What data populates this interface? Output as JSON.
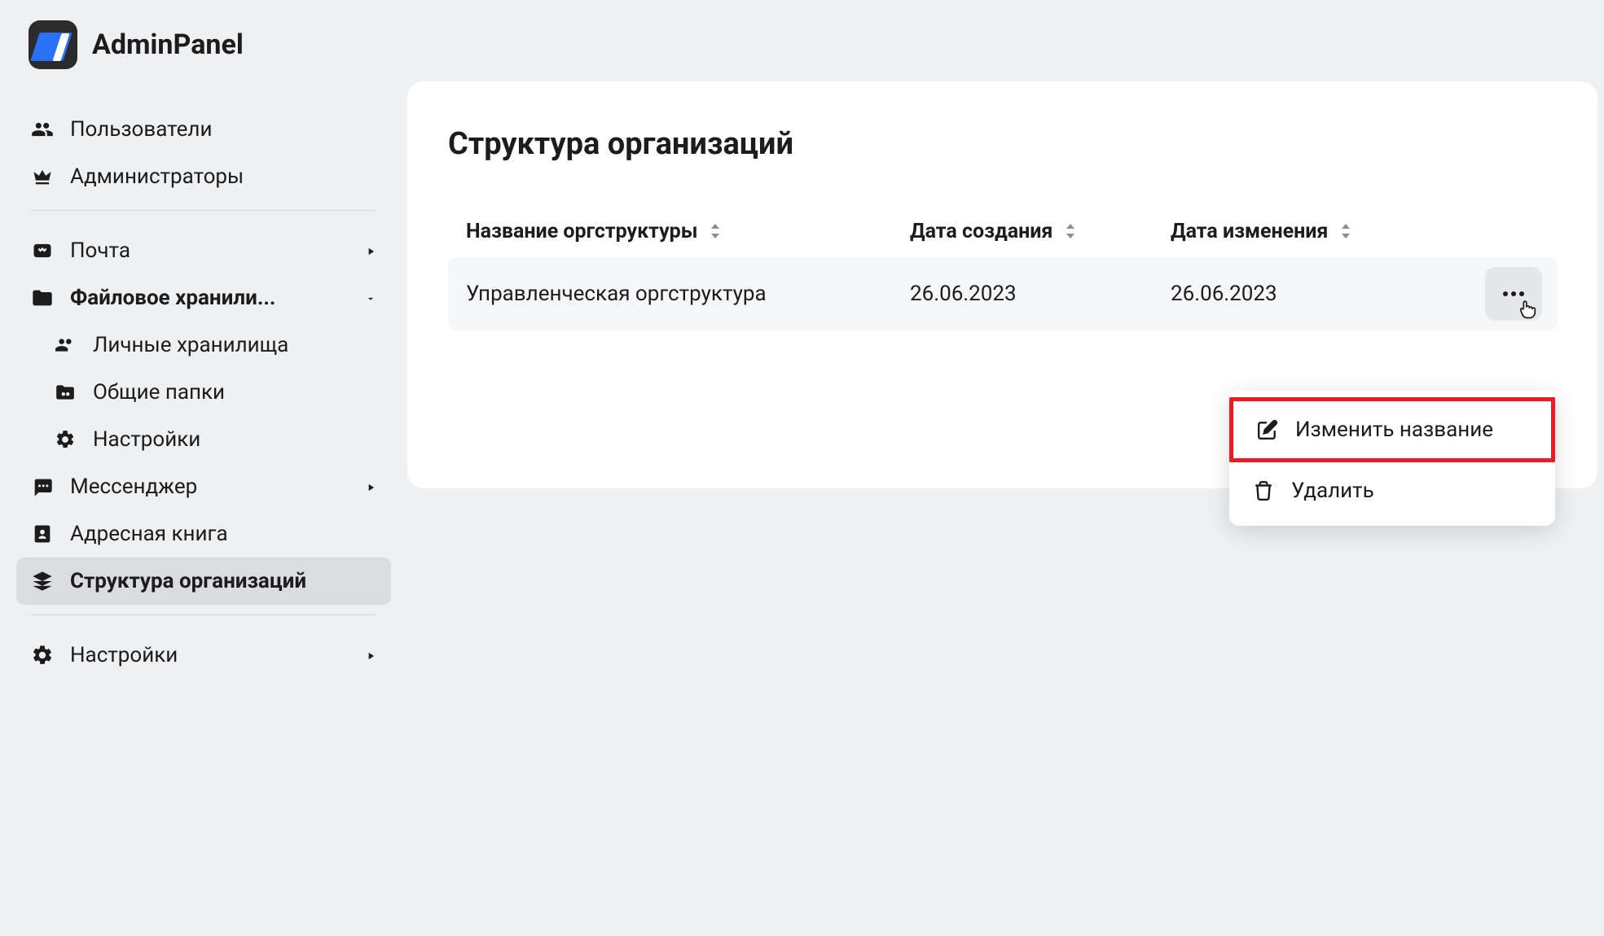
{
  "app_name": "AdminPanel",
  "sidebar": {
    "items": [
      {
        "label": "Пользователи"
      },
      {
        "label": "Администраторы"
      },
      {
        "label": "Почта"
      },
      {
        "label": "Файловое хранили..."
      },
      {
        "label": "Личные хранилища"
      },
      {
        "label": "Общие папки"
      },
      {
        "label": "Настройки"
      },
      {
        "label": "Мессенджер"
      },
      {
        "label": "Адресная книга"
      },
      {
        "label": "Структура организаций"
      },
      {
        "label": "Настройки"
      }
    ]
  },
  "main": {
    "title": "Структура организаций",
    "columns": {
      "name": "Название оргструктуры",
      "created": "Дата создания",
      "modified": "Дата изменения"
    },
    "rows": [
      {
        "name": "Управленческая оргструктура",
        "created": "26.06.2023",
        "modified": "26.06.2023"
      }
    ]
  },
  "context_menu": {
    "rename": "Изменить название",
    "delete": "Удалить"
  }
}
